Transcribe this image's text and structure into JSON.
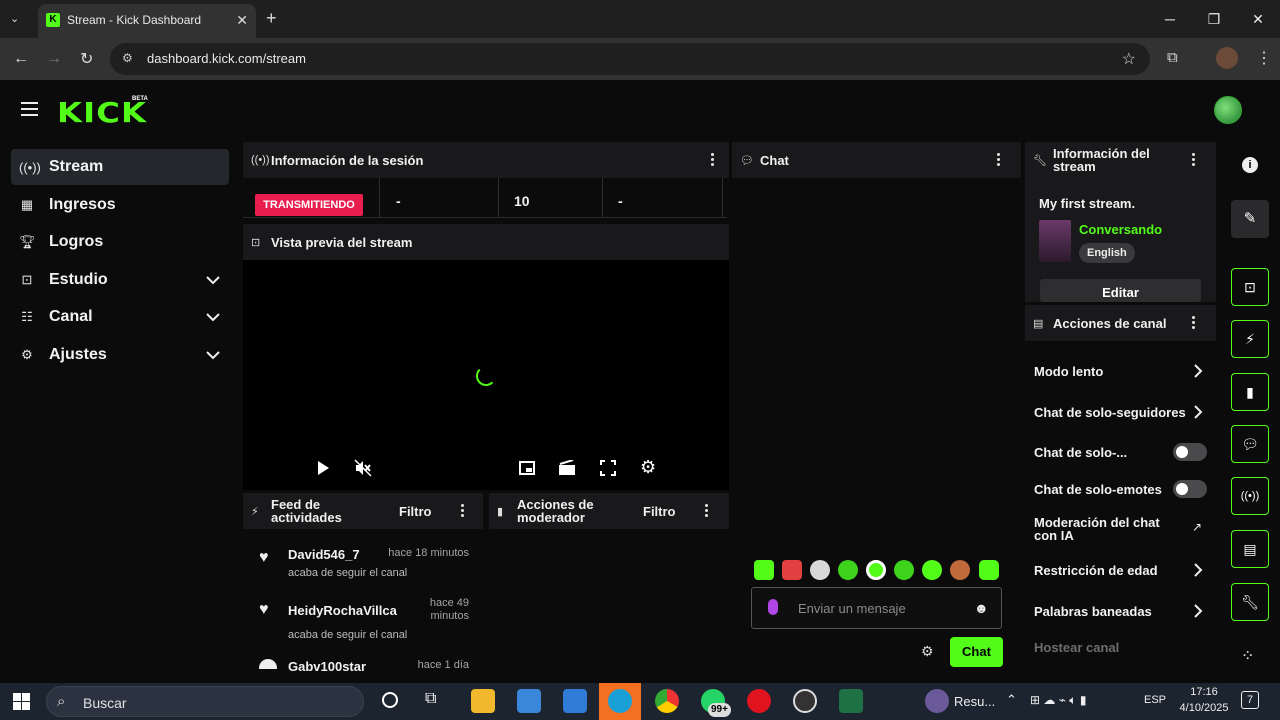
{
  "browser": {
    "tab_title": "Stream - Kick Dashboard",
    "url": "dashboard.kick.com/stream"
  },
  "app": {
    "logo": "KICK",
    "logo_badge": "BETA"
  },
  "sidebar": {
    "items": [
      {
        "label": "Stream",
        "icon": "broadcast-icon",
        "active": true
      },
      {
        "label": "Ingresos",
        "icon": "chart-icon"
      },
      {
        "label": "Logros",
        "icon": "trophy-icon"
      },
      {
        "label": "Estudio",
        "icon": "studio-icon"
      },
      {
        "label": "Canal",
        "icon": "users-icon"
      },
      {
        "label": "Ajustes",
        "icon": "gear-icon"
      }
    ]
  },
  "session": {
    "title": "Información de la sesión",
    "live_badge": "TRANSMITIENDO",
    "stat1": "-",
    "stat2": "10",
    "stat3": "-"
  },
  "preview": {
    "title": "Vista previa del stream"
  },
  "feed": {
    "title": "Feed de actividades",
    "filter": "Filtro",
    "items": [
      {
        "name": "David546_7",
        "time": "hace 18 minutos",
        "desc": "acaba de seguir el canal"
      },
      {
        "name": "HeidyRochaVillca",
        "time": "hace 49 minutos",
        "desc": "acaba de seguir el canal"
      },
      {
        "name": "Gabv100star",
        "time": "hace 1 día",
        "desc": ""
      }
    ]
  },
  "mod": {
    "title": "Acciones de moderador",
    "filter": "Filtro"
  },
  "chat": {
    "title": "Chat",
    "placeholder": "Enviar un mensaje",
    "send": "Chat"
  },
  "stream_info": {
    "title": "Información del stream",
    "stream_title": "My first stream.",
    "category": "Conversando",
    "language": "English",
    "edit": "Editar",
    "category_color": "#53fc18"
  },
  "channel_actions": {
    "title": "Acciones de canal",
    "items": [
      {
        "label": "Modo lento",
        "control": "chevron"
      },
      {
        "label": "Chat de solo-seguidores",
        "control": "chevron"
      },
      {
        "label": "Chat de solo-...",
        "control": "toggle"
      },
      {
        "label": "Chat de solo-emotes",
        "control": "toggle"
      },
      {
        "label": "Moderación del chat con IA",
        "control": "external"
      },
      {
        "label": "Restricción de edad",
        "control": "chevron"
      },
      {
        "label": "Palabras baneadas",
        "control": "chevron"
      },
      {
        "label": "Hostear canal",
        "control": "none"
      }
    ]
  },
  "taskbar": {
    "search": "Buscar",
    "badge": "99+",
    "app_label": "Resu...",
    "lang": "ESP",
    "time": "17:16",
    "date": "4/10/2025",
    "notif": "7"
  },
  "colors": {
    "accent": "#53fc18",
    "live": "#e91e4e",
    "panel": "#19191b",
    "background": "#0b0b0c"
  }
}
